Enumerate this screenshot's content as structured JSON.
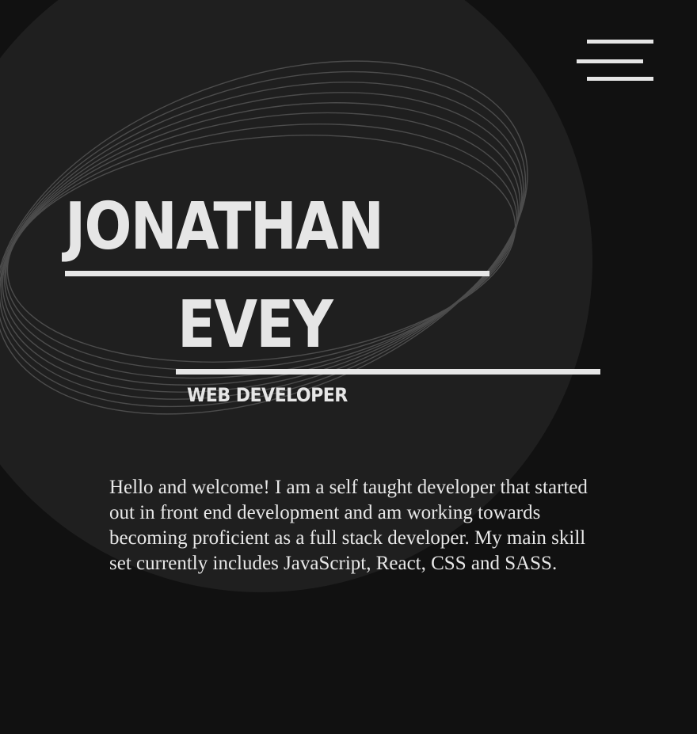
{
  "header": {
    "menu_icon": "hamburger-menu-icon"
  },
  "hero": {
    "first_name": "JONATHAN",
    "last_name": "EVEY",
    "role": "WEB DEVELOPER"
  },
  "about": {
    "text": "Hello and welcome! I am a self taught developer that started out in front end development and am working towards becoming proficient as a full stack developer. My main skill set currently includes JavaScript, React, CSS and SASS."
  },
  "colors": {
    "background": "#111111",
    "circle": "#1e1e1e",
    "text": "#e6e6e6",
    "art_lines": "#4a4a4a"
  }
}
